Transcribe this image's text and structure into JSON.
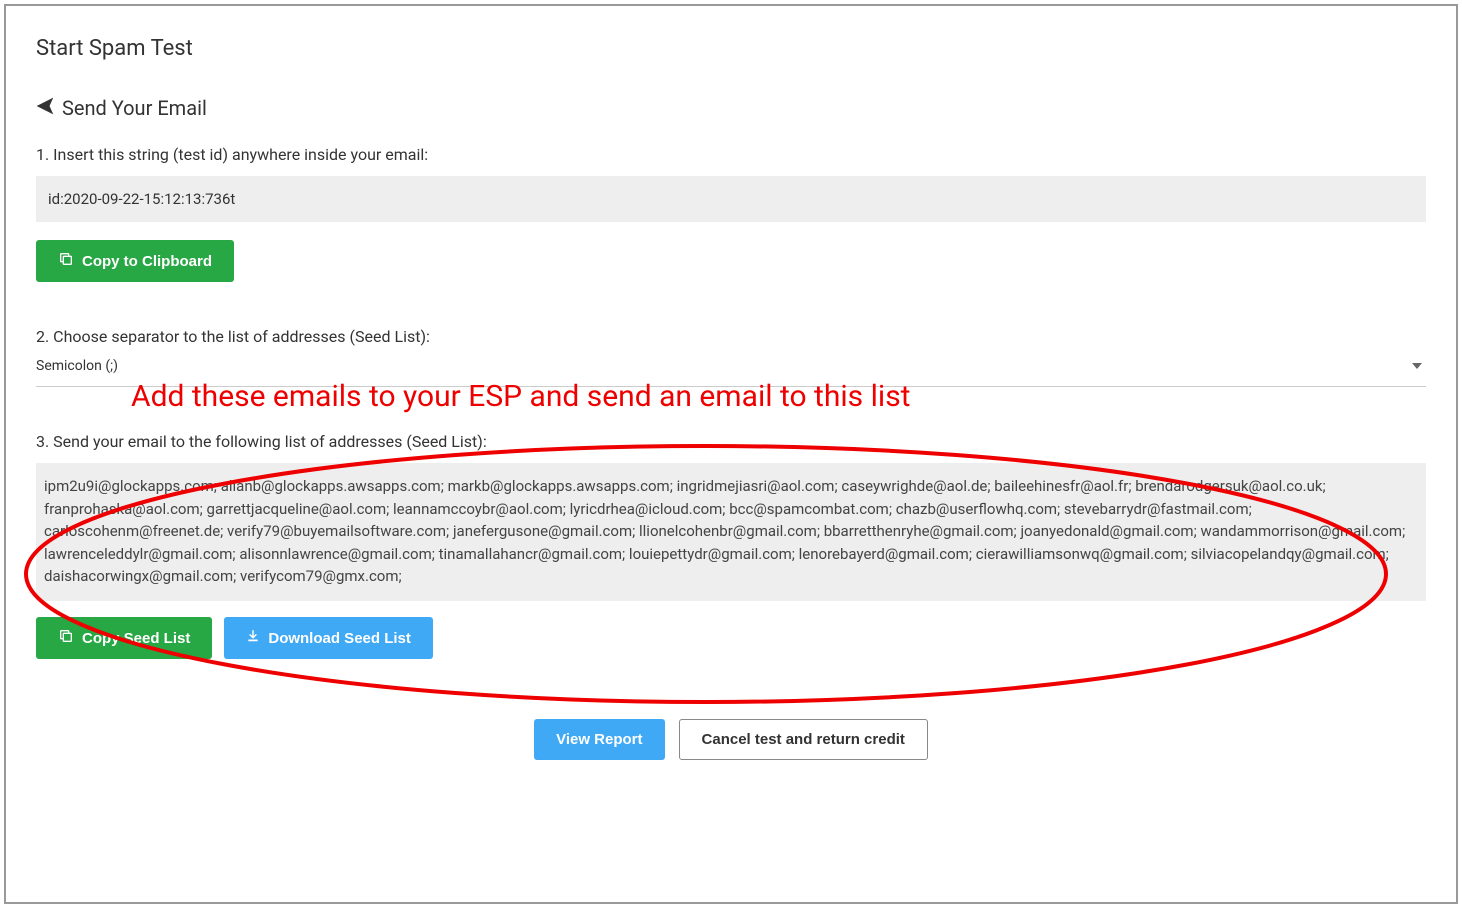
{
  "page_title": "Start Spam Test",
  "section_header": "Send Your Email",
  "step1": {
    "label": "1. Insert this string (test id) anywhere inside your email:",
    "test_id": "id:2020-09-22-15:12:13:736t",
    "copy_button": "Copy to Clipboard"
  },
  "step2": {
    "label": "2. Choose separator to the list of addresses (Seed List):",
    "selected_value": "Semicolon (;)"
  },
  "step3": {
    "label": "3. Send your email to the following list of addresses (Seed List):",
    "seed_list": "ipm2u9i@glockapps.com; allanb@glockapps.awsapps.com; markb@glockapps.awsapps.com; ingridmejiasri@aol.com; caseywrighde@aol.de; baileehinesfr@aol.fr; brendarodgersuk@aol.co.uk; franprohaska@aol.com; garrettjacqueline@aol.com; leannamccoybr@aol.com; lyricdrhea@icloud.com; bcc@spamcombat.com; chazb@userflowhq.com; stevebarrydr@fastmail.com; carloscohenm@freenet.de; verify79@buyemailsoftware.com; janefergusone@gmail.com; llionelcohenbr@gmail.com; bbarretthenryhe@gmail.com; joanyedonald@gmail.com; wandammorrison@gmail.com; lawrenceleddylr@gmail.com; alisonnlawrence@gmail.com; tinamallahancr@gmail.com; louiepettydr@gmail.com; lenorebayerd@gmail.com; cierawilliamsonwq@gmail.com; silviacopelandqy@gmail.com; daishacorwingx@gmail.com; verifycom79@gmx.com;",
    "copy_button": "Copy Seed List",
    "download_button": "Download Seed List"
  },
  "footer": {
    "view_report": "View Report",
    "cancel": "Cancel test and return credit"
  },
  "annotation": {
    "text": "Add these emails to your ESP and send an email to this list"
  }
}
